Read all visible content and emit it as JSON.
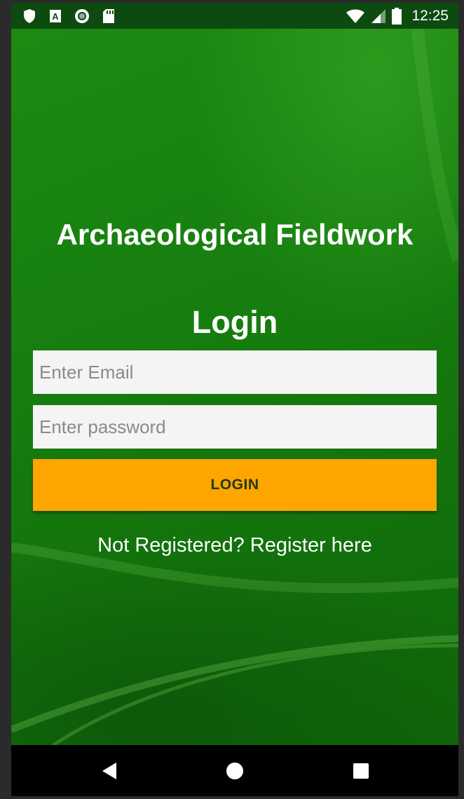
{
  "status_bar": {
    "time": "12:25",
    "left_icons": [
      "shield-icon",
      "a-box-icon",
      "record-icon",
      "sd-card-icon"
    ],
    "right_icons": [
      "wifi-icon",
      "cell-signal-icon",
      "battery-icon"
    ]
  },
  "main": {
    "app_title": "Archaeological Fieldwork",
    "login_title": "Login",
    "email_placeholder": "Enter Email",
    "email_value": "",
    "password_placeholder": "Enter password",
    "password_value": "",
    "login_button_label": "LOGIN",
    "register_link": "Not Registered? Register here"
  },
  "nav_bar": {
    "buttons": [
      "back-icon",
      "home-icon",
      "recents-icon"
    ]
  },
  "colors": {
    "background_green": "#17800f",
    "status_bar": "#0d4a10",
    "login_button": "#ffa500",
    "input_background": "#f4f4f4"
  }
}
